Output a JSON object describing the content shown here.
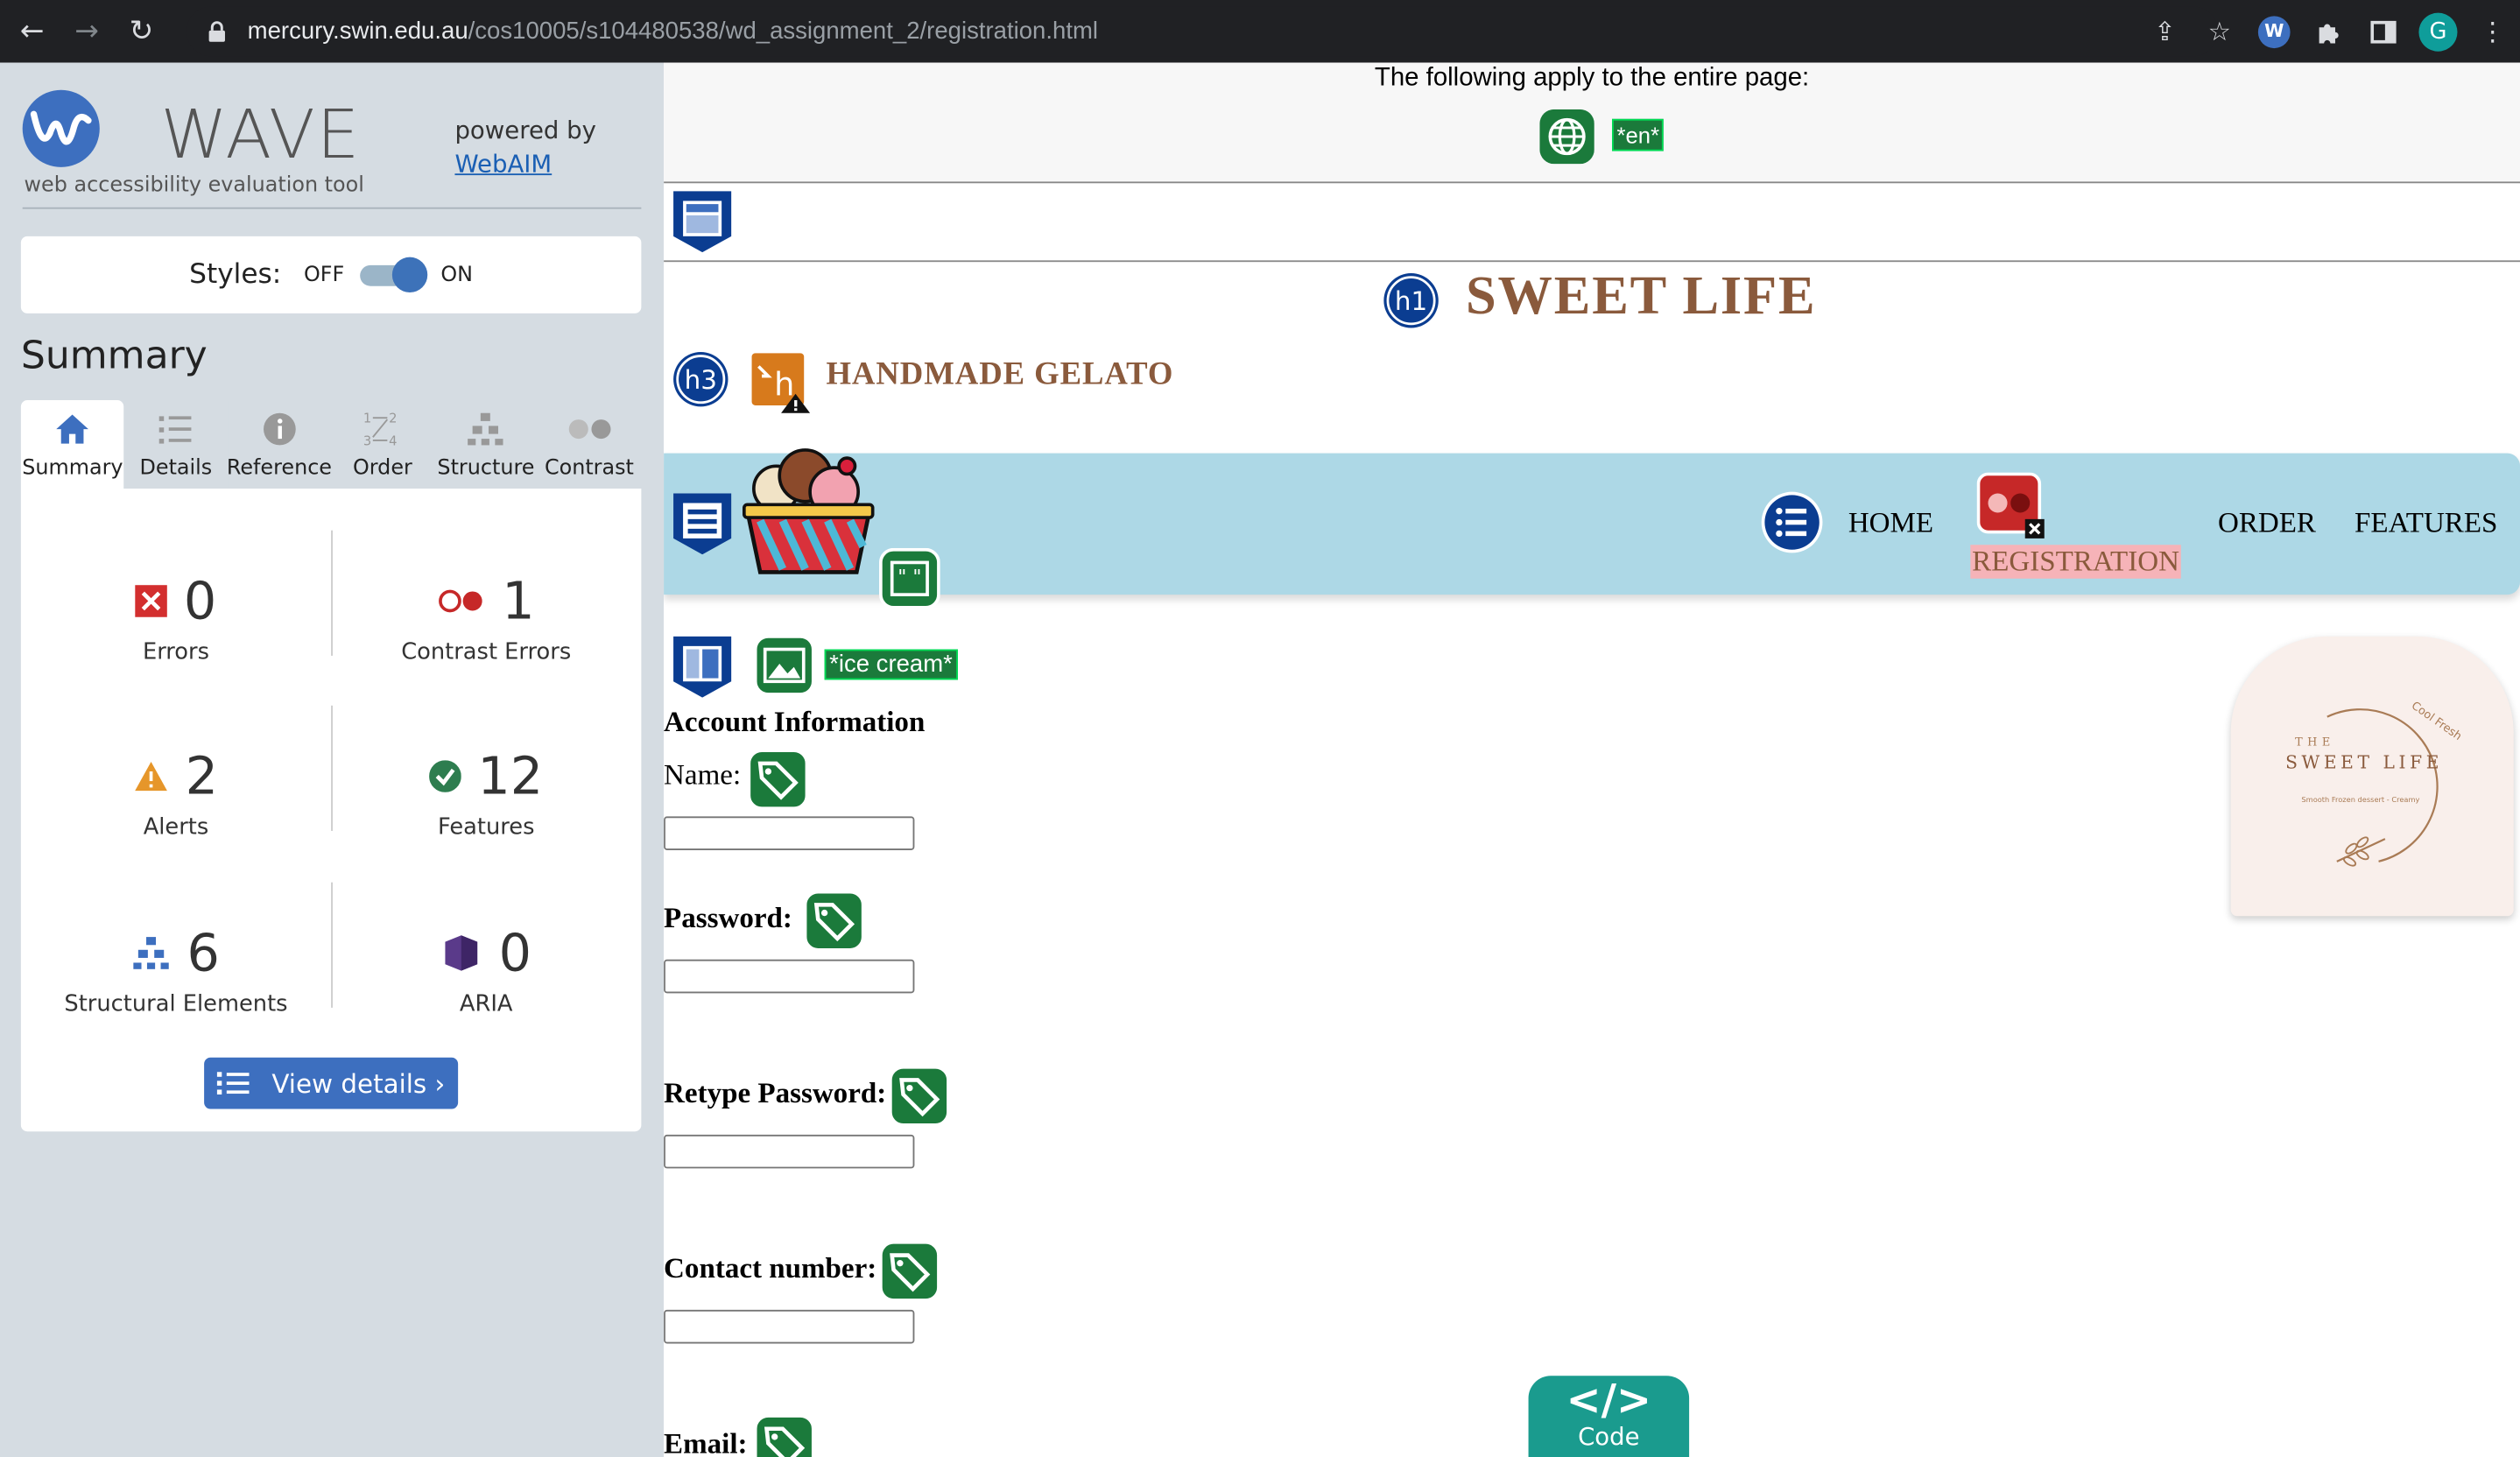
{
  "browser": {
    "url_host": "mercury.swin.edu.au",
    "url_path": "/cos10005/s104480538/wd_assignment_2/registration.html",
    "profile_initial": "G",
    "wave_ext_label": "W"
  },
  "wave": {
    "brand": "WAVE",
    "tagline": "web accessibility evaluation tool",
    "powered_by": "powered by",
    "webaim_link": "WebAIM",
    "styles_label": "Styles:",
    "styles_off": "OFF",
    "styles_on": "ON",
    "summary_heading": "Summary",
    "tabs": [
      {
        "label": "Summary",
        "active": true
      },
      {
        "label": "Details"
      },
      {
        "label": "Reference"
      },
      {
        "label": "Order"
      },
      {
        "label": "Structure"
      },
      {
        "label": "Contrast"
      }
    ],
    "stats": {
      "errors": {
        "count": "0",
        "label": "Errors"
      },
      "contrast": {
        "count": "1",
        "label": "Contrast Errors"
      },
      "alerts": {
        "count": "2",
        "label": "Alerts"
      },
      "features": {
        "count": "12",
        "label": "Features"
      },
      "structural": {
        "count": "6",
        "label": "Structural Elements"
      },
      "aria": {
        "count": "0",
        "label": "ARIA"
      }
    },
    "view_details": "View details ›"
  },
  "page": {
    "apply_text": "The following apply to the entire page:",
    "lang_tag": "*en*",
    "h1_badge": "h1",
    "h3_badge": "h3",
    "site_title": "SWEET LIFE",
    "subtitle": "HANDMADE GELATO",
    "nav": {
      "home": "HOME",
      "registration": "REGISTRATION",
      "order": "ORDER",
      "features": "FEATURES"
    },
    "alt_tag": "*ice cream*",
    "form_heading": "Account Information",
    "fields": [
      {
        "label": "Name:"
      },
      {
        "label": "Password:"
      },
      {
        "label": "Retype Password:"
      },
      {
        "label": "Contact number:"
      },
      {
        "label": "Email:"
      }
    ],
    "logo": {
      "the": "THE",
      "name": "SWEET LIFE",
      "arc_text": "Cool Fresh",
      "small": "Smooth Frozen dessert - Creamy"
    },
    "code_symbol": "</>",
    "code_label": "Code"
  },
  "colors": {
    "accent": "#3d6fbf",
    "nav_bg": "#add8e6",
    "brown": "#8a5a3c",
    "feature_green": "#1b7a3b",
    "code_teal": "#1a9b8e"
  }
}
